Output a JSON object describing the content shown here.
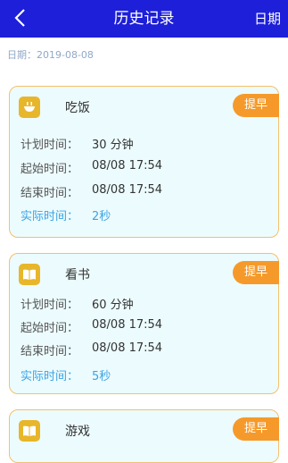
{
  "nav": {
    "title": "历史记录",
    "right_label": "日期"
  },
  "date": {
    "label": "日期：",
    "value": "2019-08-08"
  },
  "cards": [
    {
      "name": "吃饭",
      "button": "提早",
      "rows": [
        {
          "label": "计划时间：",
          "value": "30 分钟"
        },
        {
          "label": "起始时间：",
          "value": "08/08 17:54"
        },
        {
          "label": "结束时间：",
          "value": "08/08 17:54"
        },
        {
          "label": "实际时间：",
          "value": "2秒"
        }
      ]
    },
    {
      "name": "看书",
      "button": "提早",
      "rows": [
        {
          "label": "计划时间：",
          "value": "60 分钟"
        },
        {
          "label": "起始时间：",
          "value": "08/08 17:54"
        },
        {
          "label": "结束时间：",
          "value": "08/08 17:54"
        },
        {
          "label": "实际时间：",
          "value": "5秒"
        }
      ]
    },
    {
      "name": "游戏",
      "button": "提早"
    }
  ],
  "colors": {
    "nav": "#1d1fd9",
    "accent": "#f59a2a",
    "icon": "#e8b62a",
    "actual": "#3aa4e6"
  }
}
